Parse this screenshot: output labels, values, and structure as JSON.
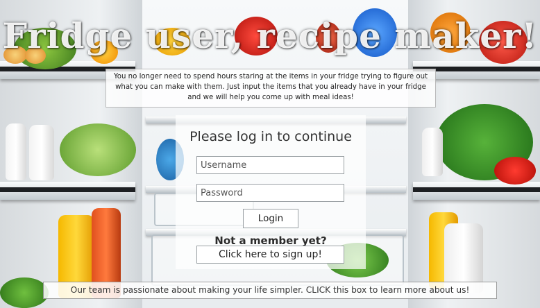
{
  "header": {
    "title": "Fridge user, recipe maker!"
  },
  "intro": {
    "text": "You no longer need to spend hours staring at the items in your fridge trying to figure out what you can make with them. Just input the items that you already have in your fridge and we will help you come up with meal ideas!"
  },
  "login": {
    "heading": "Please log in to continue",
    "username_placeholder": "Username",
    "username_value": "",
    "password_placeholder": "Password",
    "password_value": "",
    "login_label": "Login",
    "not_member_text": "Not a member yet?",
    "signup_label": "Click here to sign up!"
  },
  "footer": {
    "about_text": "Our team is passionate about making your life simpler. CLICK this box to learn more about us!"
  },
  "colors": {
    "panel_background": "#ffffff",
    "text_dark": "#222222",
    "title_text": "#ffffff"
  }
}
